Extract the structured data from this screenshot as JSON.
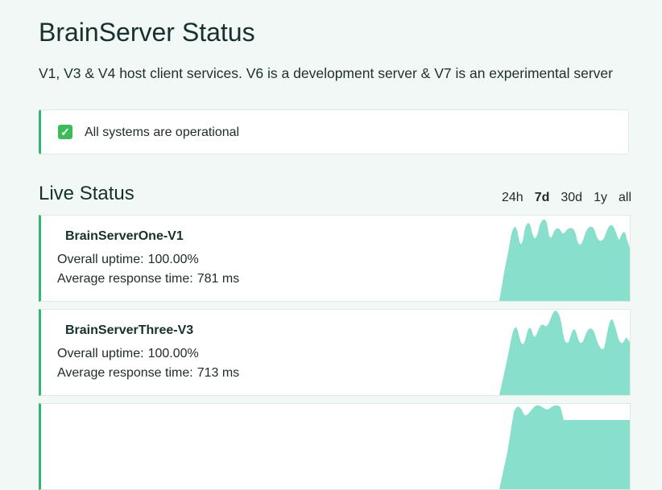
{
  "page": {
    "title": "BrainServer Status",
    "description": "V1, V3 & V4 host client services. V6 is a development server & V7 is an experimental server"
  },
  "banner": {
    "icon": "check-icon",
    "message": "All systems are operational",
    "color": "#2eb872"
  },
  "live": {
    "title": "Live Status",
    "ranges": [
      "24h",
      "7d",
      "30d",
      "1y",
      "all"
    ],
    "active_range": "7d"
  },
  "labels": {
    "uptime": "Overall uptime:",
    "response": "Average response time:"
  },
  "colors": {
    "accent": "#2eb872",
    "sparkline": "#88dfcc"
  },
  "servers": [
    {
      "name": "BrainServerOne-V1",
      "uptime": "100.00%",
      "response": "781 ms"
    },
    {
      "name": "BrainServerThree-V3",
      "uptime": "100.00%",
      "response": "713 ms"
    },
    {
      "name": ""
    }
  ]
}
